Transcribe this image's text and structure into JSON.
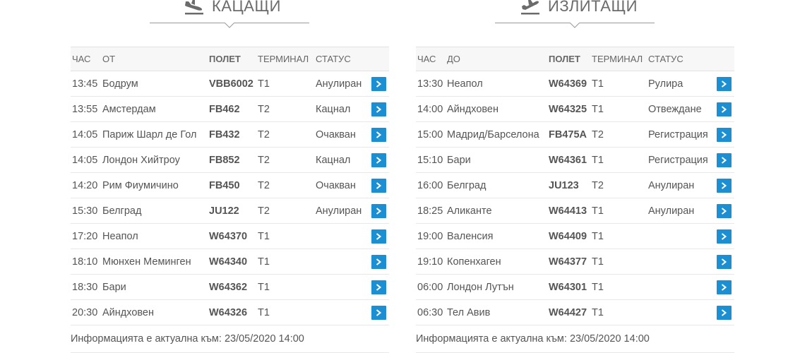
{
  "colors": {
    "accent": "#1b8fd2",
    "text": "#555555",
    "header_bg": "#f7f7f7"
  },
  "arrivals": {
    "title": "КАЦАЩИ",
    "icon": "plane-landing-icon",
    "columns": [
      "ЧАС",
      "ОТ",
      "ПОЛЕТ",
      "ТЕРМИНАЛ",
      "СТАТУС"
    ],
    "rows": [
      {
        "time": "13:45",
        "place": "Бодрум",
        "flight": "VBB6002",
        "terminal": "T1",
        "status": "Анулиран"
      },
      {
        "time": "13:55",
        "place": "Амстердам",
        "flight": "FB462",
        "terminal": "T2",
        "status": "Кацнал"
      },
      {
        "time": "14:05",
        "place": "Париж Шарл де Гол",
        "flight": "FB432",
        "terminal": "T2",
        "status": "Очакван"
      },
      {
        "time": "14:05",
        "place": "Лондон Хийтроу",
        "flight": "FB852",
        "terminal": "T2",
        "status": "Кацнал"
      },
      {
        "time": "14:20",
        "place": "Рим Фиумичино",
        "flight": "FB450",
        "terminal": "T2",
        "status": "Очакван"
      },
      {
        "time": "15:30",
        "place": "Белград",
        "flight": "JU122",
        "terminal": "T2",
        "status": "Анулиран"
      },
      {
        "time": "17:20",
        "place": "Неапол",
        "flight": "W64370",
        "terminal": "T1",
        "status": ""
      },
      {
        "time": "18:10",
        "place": "Мюнхен Меминген",
        "flight": "W64340",
        "terminal": "T1",
        "status": ""
      },
      {
        "time": "18:30",
        "place": "Бари",
        "flight": "W64362",
        "terminal": "T1",
        "status": ""
      },
      {
        "time": "20:30",
        "place": "Айндховен",
        "flight": "W64326",
        "terminal": "T1",
        "status": ""
      }
    ],
    "footer": "Информацията е актуална към: 23/05/2020 14:00"
  },
  "departures": {
    "title": "ИЗЛИТАЩИ",
    "icon": "plane-takeoff-icon",
    "columns": [
      "ЧАС",
      "ДО",
      "ПОЛЕТ",
      "ТЕРМИНАЛ",
      "СТАТУС"
    ],
    "rows": [
      {
        "time": "13:30",
        "place": "Неапол",
        "flight": "W64369",
        "terminal": "T1",
        "status": "Рулира"
      },
      {
        "time": "14:00",
        "place": "Айндховен",
        "flight": "W64325",
        "terminal": "T1",
        "status": "Отвеждане"
      },
      {
        "time": "15:00",
        "place": "Мадрид/Барселона",
        "flight": "FB475A",
        "terminal": "T2",
        "status": "Регистрация"
      },
      {
        "time": "15:10",
        "place": "Бари",
        "flight": "W64361",
        "terminal": "T1",
        "status": "Регистрация"
      },
      {
        "time": "16:00",
        "place": "Белград",
        "flight": "JU123",
        "terminal": "T2",
        "status": "Анулиран"
      },
      {
        "time": "18:25",
        "place": "Аликанте",
        "flight": "W64413",
        "terminal": "T1",
        "status": "Анулиран"
      },
      {
        "time": "19:00",
        "place": "Валенсия",
        "flight": "W64409",
        "terminal": "T1",
        "status": ""
      },
      {
        "time": "19:10",
        "place": "Копенхаген",
        "flight": "W64377",
        "terminal": "T1",
        "status": ""
      },
      {
        "time": "06:00",
        "place": "Лондон Лутън",
        "flight": "W64301",
        "terminal": "T1",
        "status": ""
      },
      {
        "time": "06:30",
        "place": "Тел Авив",
        "flight": "W64427",
        "terminal": "T1",
        "status": ""
      }
    ],
    "footer": "Информацията е актуална към: 23/05/2020 14:00"
  }
}
